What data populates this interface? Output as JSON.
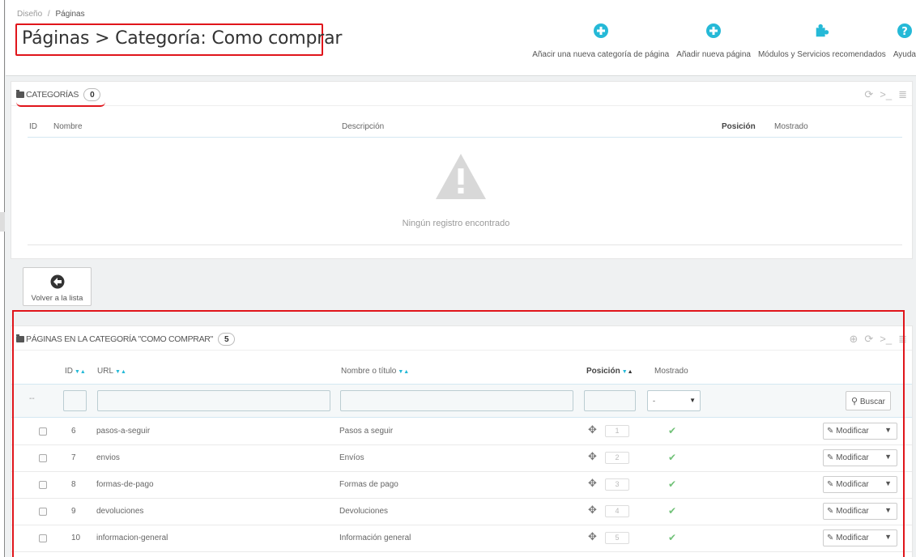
{
  "breadcrumb": {
    "parent": "Diseño",
    "separator": "/",
    "current": "Páginas"
  },
  "page_title": "Páginas > Categoría: Como comprar",
  "toolbar": {
    "add_category": "Añacir una nueva categoría de página",
    "add_page": "Añadir nueva página",
    "modules": "Módulos y Servicios recomendados",
    "help": "Ayuda"
  },
  "categories_panel": {
    "title": "Categorías",
    "count": "0",
    "columns": {
      "id": "ID",
      "name": "Nombre",
      "description": "Descripción",
      "position": "Posición",
      "shown": "Mostrado"
    },
    "empty_message": "Ningún registro encontrado"
  },
  "back_button": {
    "label": "Volver a la lista"
  },
  "pages_panel": {
    "title": "Páginas en la categoría \"Como comprar\"",
    "count": "5",
    "columns": {
      "id": "ID",
      "url": "URL",
      "name": "Nombre o título",
      "position": "Posición",
      "shown": "Mostrado"
    },
    "filter": {
      "dash": "--",
      "select_value": "-",
      "search_label": "Buscar"
    },
    "rows": [
      {
        "id": "6",
        "url": "pasos-a-seguir",
        "name": "Pasos a seguir",
        "position": "1",
        "action": "Modificar"
      },
      {
        "id": "7",
        "url": "envios",
        "name": "Envíos",
        "position": "2",
        "action": "Modificar"
      },
      {
        "id": "8",
        "url": "formas-de-pago",
        "name": "Formas de pago",
        "position": "3",
        "action": "Modificar"
      },
      {
        "id": "9",
        "url": "devoluciones",
        "name": "Devoluciones",
        "position": "4",
        "action": "Modificar"
      },
      {
        "id": "10",
        "url": "informacion-general",
        "name": "Información general",
        "position": "5",
        "action": "Modificar"
      }
    ]
  },
  "colors": {
    "accent": "#25b9d7",
    "highlight_red": "#e0151b",
    "check_green": "#72c279"
  }
}
